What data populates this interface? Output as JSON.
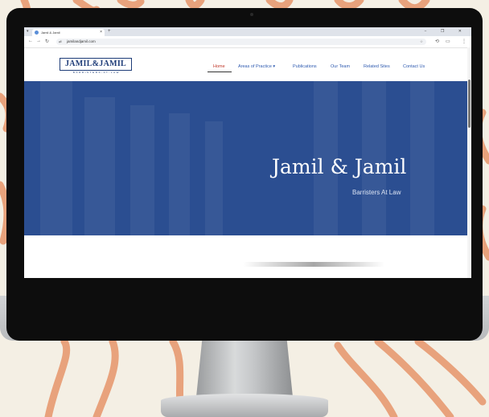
{
  "browser": {
    "tab_title": "Jamil & Jamil",
    "tab_close": "×",
    "new_tab": "+",
    "url": "jamilandjamil.com",
    "window_controls": "− ❐ ✕",
    "nav": {
      "back": "←",
      "forward": "→",
      "reload": "↻"
    },
    "bookmark_star": "☆"
  },
  "site": {
    "logo_text": "JAMIL&JAMIL",
    "logo_subtext": "BARRISTERS-AT-LAW",
    "nav": [
      {
        "label": "Home"
      },
      {
        "label": "Areas of Practice ▾"
      },
      {
        "label": "Publications"
      },
      {
        "label": "Our Team"
      },
      {
        "label": "Related Sites"
      },
      {
        "label": "Contact Us"
      }
    ]
  },
  "hero": {
    "title": "Jamil & Jamil",
    "subtitle": "Barristers At Law"
  },
  "colors": {
    "hero_blue": "#2b4e91",
    "logo_navy": "#1e3c78",
    "nav_link": "#2f5bb0",
    "nav_active": "#c0392b",
    "background_cream": "#f4efe4",
    "swirl_orange": "#e8a27c"
  }
}
